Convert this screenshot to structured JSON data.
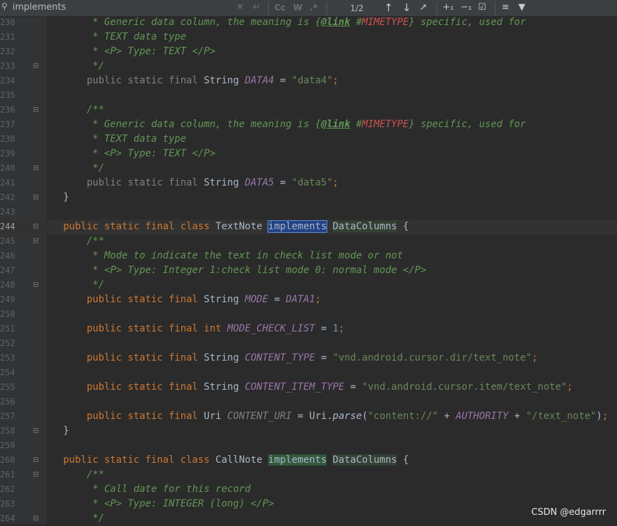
{
  "search": {
    "query": "implements",
    "match_count": "1/2"
  },
  "toolbar": {
    "match_case_label": "Cc",
    "words_label": "W",
    "regex_label": ".*"
  },
  "watermark": "CSDN @edgarrrr",
  "lines": [
    {
      "n": "230",
      "html": "     <span class='cm'>* Generic data column, the meaning is {<span class='tagm'>@link</span> #<span class='ref'>MIMETYPE</span>} specific, used for</span>"
    },
    {
      "n": "231",
      "html": "     <span class='cm'>* TEXT data type</span>"
    },
    {
      "n": "232",
      "html": "     <span class='cm'>* &lt;P&gt; Type: TEXT &lt;/P&gt;</span>"
    },
    {
      "n": "233",
      "fold": true,
      "html": "     <span class='cm'>*/</span>"
    },
    {
      "n": "234",
      "html": "    <span class='kwg'>public static final</span> String <span class='fld'>DATA4</span> = <span class='str'>\"data4\"</span><span class='kw'>;</span>"
    },
    {
      "n": "235",
      "html": ""
    },
    {
      "n": "236",
      "fold": true,
      "html": "    <span class='cm'>/**</span>"
    },
    {
      "n": "237",
      "html": "     <span class='cm'>* Generic data column, the meaning is {<span class='tagm'>@link</span> #<span class='ref'>MIMETYPE</span>} specific, used for</span>"
    },
    {
      "n": "238",
      "html": "     <span class='cm'>* TEXT data type</span>"
    },
    {
      "n": "239",
      "html": "     <span class='cm'>* &lt;P&gt; Type: TEXT &lt;/P&gt;</span>"
    },
    {
      "n": "240",
      "fold": true,
      "html": "     <span class='cm'>*/</span>"
    },
    {
      "n": "241",
      "html": "    <span class='kwg'>public static final</span> String <span class='fld'>DATA5</span> = <span class='str'>\"data5\"</span><span class='kw'>;</span>"
    },
    {
      "n": "242",
      "fold": true,
      "html": "}"
    },
    {
      "n": "243",
      "html": ""
    },
    {
      "n": "244",
      "current": true,
      "fold": true,
      "html": "<span class='kw'>public static final class</span> TextNote <span class='hl-sel'>implements</span> <span class='hl-match2'>DataColumns</span> {"
    },
    {
      "n": "245",
      "fold": true,
      "html": "    <span class='cm'>/**</span>"
    },
    {
      "n": "246",
      "html": "     <span class='cm'>* Mode to indicate the text in check list mode or not</span>"
    },
    {
      "n": "247",
      "html": "     <span class='cm'>* &lt;P&gt; Type: Integer 1:check list mode 0: normal mode &lt;/P&gt;</span>"
    },
    {
      "n": "248",
      "fold": true,
      "html": "     <span class='cm'>*/</span>"
    },
    {
      "n": "249",
      "html": "    <span class='kw'>public static final</span> String <span class='fld'>MODE</span> = <span class='fld'>DATA1</span><span class='kw'>;</span>"
    },
    {
      "n": "250",
      "html": ""
    },
    {
      "n": "251",
      "html": "    <span class='kw'>public static final int</span> <span class='fld'>MODE_CHECK_LIST</span> = <span class='num'>1</span><span class='kw'>;</span>"
    },
    {
      "n": "252",
      "html": ""
    },
    {
      "n": "253",
      "html": "    <span class='kw'>public static final</span> String <span class='fld'>CONTENT_TYPE</span> = <span class='str'>\"vnd.android.cursor.dir/text_note\"</span><span class='kw'>;</span>"
    },
    {
      "n": "254",
      "html": ""
    },
    {
      "n": "255",
      "html": "    <span class='kw'>public static final</span> String <span class='fld'>CONTENT_ITEM_TYPE</span> = <span class='str'>\"vnd.android.cursor.item/text_note\"</span><span class='kw'>;</span>"
    },
    {
      "n": "256",
      "html": ""
    },
    {
      "n": "257",
      "html": "    <span class='kw'>public static final</span> Uri <span class='fldg'>CONTENT_URI</span> = Uri.<span class='meth'>parse</span>(<span class='str'>\"content://\"</span> + <span class='fld'>AUTHORITY</span> + <span class='str'>\"/text_note\"</span>)<span class='kw'>;</span>"
    },
    {
      "n": "258",
      "fold": true,
      "html": "}"
    },
    {
      "n": "259",
      "html": ""
    },
    {
      "n": "260",
      "fold": true,
      "html": "<span class='kw'>public static final class</span> CallNote <span class='hl-match'>implements</span> <span class='hl-match2'>DataColumns</span> {"
    },
    {
      "n": "261",
      "fold": true,
      "html": "    <span class='cm'>/**</span>"
    },
    {
      "n": "262",
      "html": "     <span class='cm'>* Call date for this record</span>"
    },
    {
      "n": "263",
      "html": "     <span class='cm'>* &lt;P&gt; Type: INTEGER (long) &lt;/P&gt;</span>"
    },
    {
      "n": "264",
      "fold": true,
      "html": "     <span class='cm'>*/</span>"
    }
  ]
}
